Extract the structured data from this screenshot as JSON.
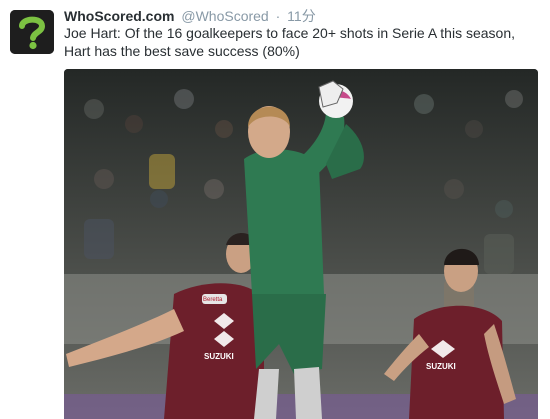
{
  "tweet": {
    "display_name": "WhoScored.com",
    "handle": "@WhoScored",
    "separator": "·",
    "time": "11分",
    "text": "Joe Hart: Of the 16 goalkeepers to face 20+ shots in Serie A this season, Hart has the best save success (80%)"
  },
  "avatar": {
    "icon": "question-mark-icon",
    "accent": "#7cc242",
    "background": "#1e1e1e"
  },
  "media": {
    "icon": "football-photo",
    "colors": {
      "keeper_kit": "#2f7a52",
      "outfield_kit": "#6d1f2b",
      "crowd": "#3b3f3e"
    },
    "shirt_texts": {
      "sponsor_left": "SUZUKI",
      "sponsor_right": "SUZUKI",
      "brand": "Beretta"
    }
  }
}
